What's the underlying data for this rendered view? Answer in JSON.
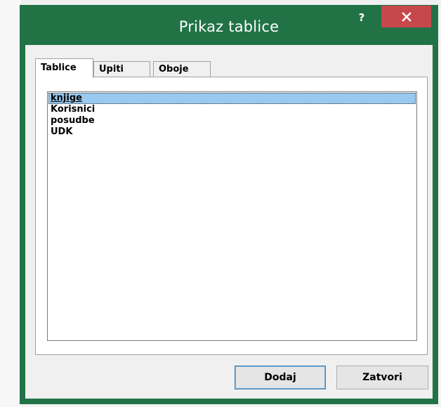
{
  "dialog": {
    "title": "Prikaz tablice",
    "help_label": "?",
    "close_icon": "close-icon",
    "colors": {
      "frame": "#217346",
      "close_button": "#c7484a",
      "selection": "#99c9ef"
    }
  },
  "tabs": [
    {
      "label": "Tablice",
      "active": true
    },
    {
      "label": "Upiti",
      "active": false
    },
    {
      "label": "Oboje",
      "active": false
    }
  ],
  "list": {
    "items": [
      "knjige",
      "Korisnici",
      "posudbe",
      "UDK"
    ],
    "selected": "knjige"
  },
  "buttons": {
    "add_label": "Dodaj",
    "close_label": "Zatvori"
  }
}
